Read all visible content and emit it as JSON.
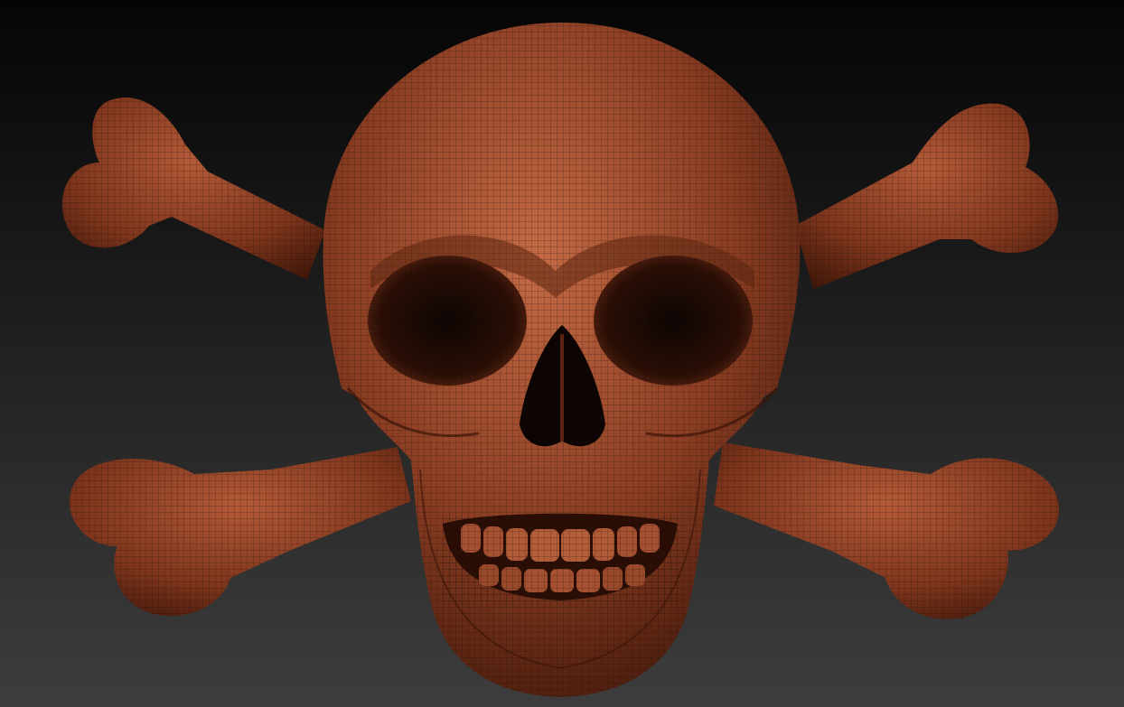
{
  "scene": {
    "subject": "skull-and-crossbones-sculpt",
    "view": "front",
    "render_style": "wireframe-mesh-on-clay",
    "has_visible_text": false
  },
  "colors": {
    "background_top": "#050505",
    "background_bottom": "#3d3d3d",
    "clay_base": "#8a3d22",
    "clay_highlight": "#c56a45",
    "clay_shadow": "#3a1408",
    "mesh_line": "#1a0a05",
    "cavity": "#0d0503"
  },
  "icons": {
    "skull": "skull-icon",
    "bone": "bone-icon"
  }
}
